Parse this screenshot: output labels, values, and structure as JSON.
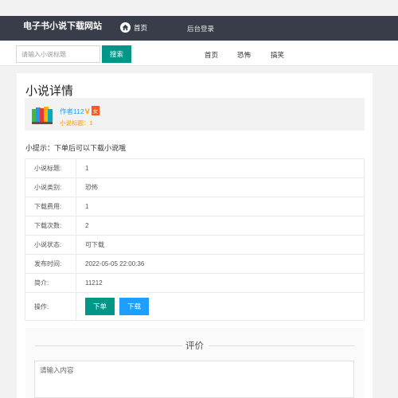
{
  "header": {
    "site_title": "电子书小说下载网站",
    "home_label": "首页",
    "admin_label": "后台登录"
  },
  "search": {
    "placeholder": "请输入小说标题",
    "button_label": "搜索"
  },
  "subnav": {
    "items": [
      "首页",
      "恐怖",
      "搞笑"
    ]
  },
  "detail": {
    "page_title": "小说详情",
    "author": "作者112",
    "verified_mark": "V",
    "gender_badge": "女",
    "novel_title_line": "小说标题：1",
    "tip": "小提示：下单后可以下载小说哦",
    "rows": [
      {
        "label": "小说标题",
        "value": "1"
      },
      {
        "label": "小说类别",
        "value": "恐怖"
      },
      {
        "label": "下载费用",
        "value": "1"
      },
      {
        "label": "下载次数",
        "value": "2"
      },
      {
        "label": "小说状态",
        "value": "可下载"
      },
      {
        "label": "发布时间",
        "value": "2022-05-05 22:00:36"
      },
      {
        "label": "简介",
        "value": "11212"
      }
    ],
    "operation_label": "操作",
    "order_button": "下单",
    "download_button": "下载"
  },
  "review": {
    "title": "评价",
    "placeholder": "请输入内容"
  },
  "colors": {
    "header_bg": "#393d49",
    "primary_green": "#009688",
    "primary_blue": "#1e9fff",
    "accent_orange": "#ff9800",
    "badge_red": "#ff5722"
  }
}
